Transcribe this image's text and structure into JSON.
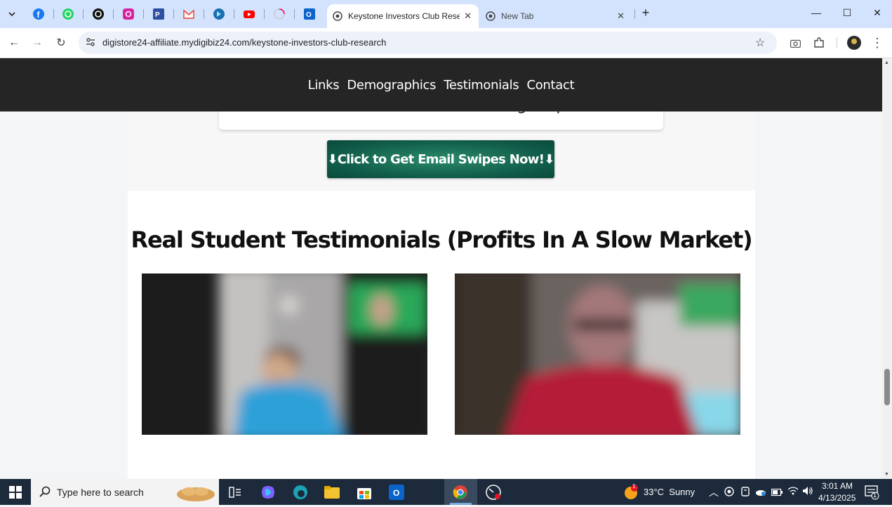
{
  "browser": {
    "pinned_tabs": [
      "facebook-icon",
      "whatsapp-icon",
      "threads-icon",
      "instagram-icon",
      "pinterest-icon",
      "gmail-icon",
      "edge-bing-icon",
      "youtube-icon",
      "loading-icon",
      "outlook-icon"
    ],
    "tabs": [
      {
        "title": "Keystone Investors Club Resear",
        "active": true
      },
      {
        "title": "New Tab",
        "active": false
      }
    ],
    "url": "digistore24-affiliate.mydigibiz24.com/keystone-investors-club-research",
    "colors": {
      "tabbar": "#d3e3fd",
      "active_tab": "#ffffff"
    }
  },
  "site": {
    "nav": [
      "Links",
      "Demographics",
      "Testimonials",
      "Contact"
    ],
    "swipe_card_text": "LATEST and Greatest Conversion Busting Swipes NOW!",
    "cta_label": "⬇Click to Get Email Swipes Now!⬇",
    "section_title": "Real Student Testimonials (Profits In A Slow Market)",
    "videos": [
      "testimonial-video-1",
      "testimonial-video-2"
    ],
    "colors": {
      "nav_bg": "#252525",
      "cta_bg": "#0f5a48"
    }
  },
  "taskbar": {
    "search_placeholder": "Type here to search",
    "weather": "33°C  Sunny",
    "time": "3:01 AM",
    "date": "4/13/2025",
    "notification_count": "1",
    "weather_badge": "1"
  }
}
